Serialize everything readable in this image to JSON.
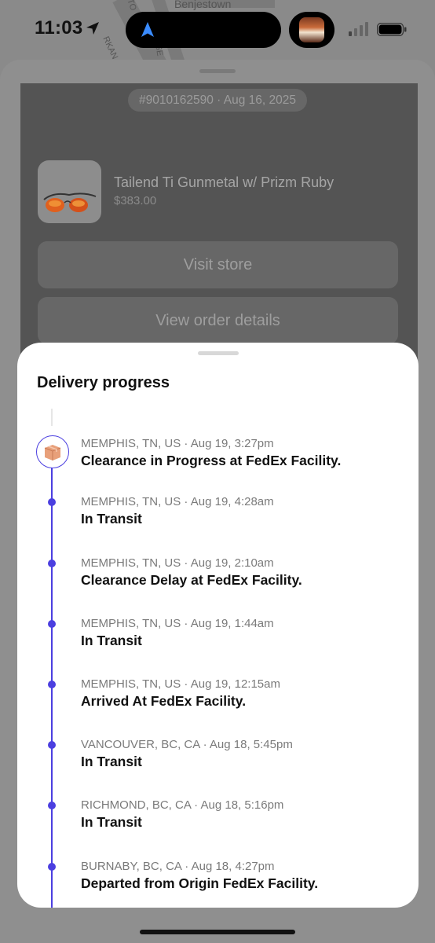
{
  "status_bar": {
    "time": "11:03"
  },
  "map": {
    "place_label": "Benjestown",
    "street_labels": [
      "TO",
      "RKAN",
      "SE"
    ]
  },
  "order": {
    "number_date": "#9010162590 · Aug 16, 2025",
    "product_title": "Tailend Ti Gunmetal w/ Prizm Ruby",
    "product_price": "$383.00",
    "visit_store": "Visit store",
    "view_details": "View order details"
  },
  "sheet": {
    "title": "Delivery progress",
    "events": [
      {
        "meta": "MEMPHIS, TN, US · Aug 19, 3:27pm",
        "status": "Clearance in Progress at FedEx Facility."
      },
      {
        "meta": "MEMPHIS, TN, US · Aug 19, 4:28am",
        "status": "In Transit"
      },
      {
        "meta": "MEMPHIS, TN, US · Aug 19, 2:10am",
        "status": "Clearance Delay at FedEx Facility."
      },
      {
        "meta": "MEMPHIS, TN, US · Aug 19, 1:44am",
        "status": "In Transit"
      },
      {
        "meta": "MEMPHIS, TN, US · Aug 19, 12:15am",
        "status": "Arrived At FedEx Facility."
      },
      {
        "meta": "VANCOUVER, BC, CA · Aug 18, 5:45pm",
        "status": "In Transit"
      },
      {
        "meta": "RICHMOND, BC, CA · Aug 18, 5:16pm",
        "status": "In Transit"
      },
      {
        "meta": "BURNABY, BC, CA · Aug 18, 4:27pm",
        "status": "Departed from Origin FedEx Facility."
      }
    ]
  },
  "colors": {
    "accent": "#4b3fe0",
    "sheet_bg": "#ffffff",
    "overlay": "#8e8e8e"
  },
  "icons": [
    "location-arrow-icon",
    "navigation-icon",
    "signal-icon",
    "battery-icon",
    "package-icon"
  ]
}
